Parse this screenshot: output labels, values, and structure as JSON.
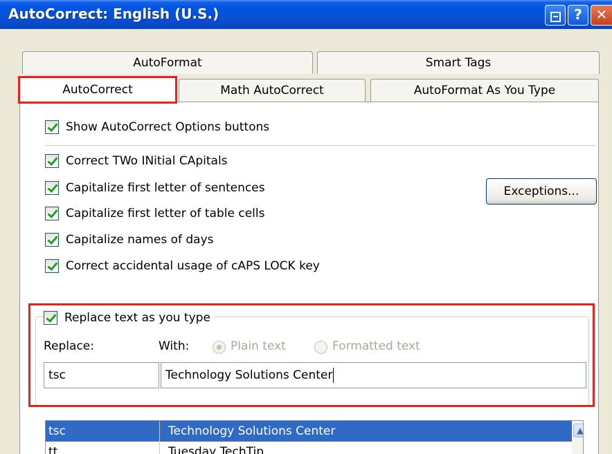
{
  "window": {
    "title": "AutoCorrect: English (U.S.)",
    "min_button_label": "",
    "help_button_label": "?",
    "close_button_label": "✕"
  },
  "tabs": {
    "row1": [
      "AutoFormat",
      "Smart Tags"
    ],
    "row2": [
      "AutoCorrect",
      "Math AutoCorrect",
      "AutoFormat As You Type"
    ],
    "active": "AutoCorrect"
  },
  "options": {
    "show_buttons": "Show AutoCorrect Options buttons",
    "correct_two_initial": "Correct TWo INitial CApitals",
    "capitalize_sentences": "Capitalize first letter of sentences",
    "capitalize_table_cells": "Capitalize first letter of table cells",
    "capitalize_days": "Capitalize names of days",
    "correct_caps_lock": "Correct accidental usage of cAPS LOCK key",
    "exceptions_button": "Exceptions..."
  },
  "replace": {
    "replace_as_type": "Replace text as you type",
    "replace_label": "Replace:",
    "with_label": "With:",
    "plain_text": "Plain text",
    "formatted_text": "Formatted text",
    "replace_value": "tsc",
    "with_value": "Technology Solutions Center"
  },
  "list": {
    "rows": [
      {
        "key": "tsc",
        "value": "Technology Solutions Center",
        "selected": true
      },
      {
        "key": "tt",
        "value": "Tuesday TechTip",
        "selected": false
      }
    ],
    "scroll_up_icon": "▲"
  },
  "colors": {
    "highlight": "#e8211b",
    "title_bar": "#0a4fd4",
    "selection": "#316ac5"
  }
}
